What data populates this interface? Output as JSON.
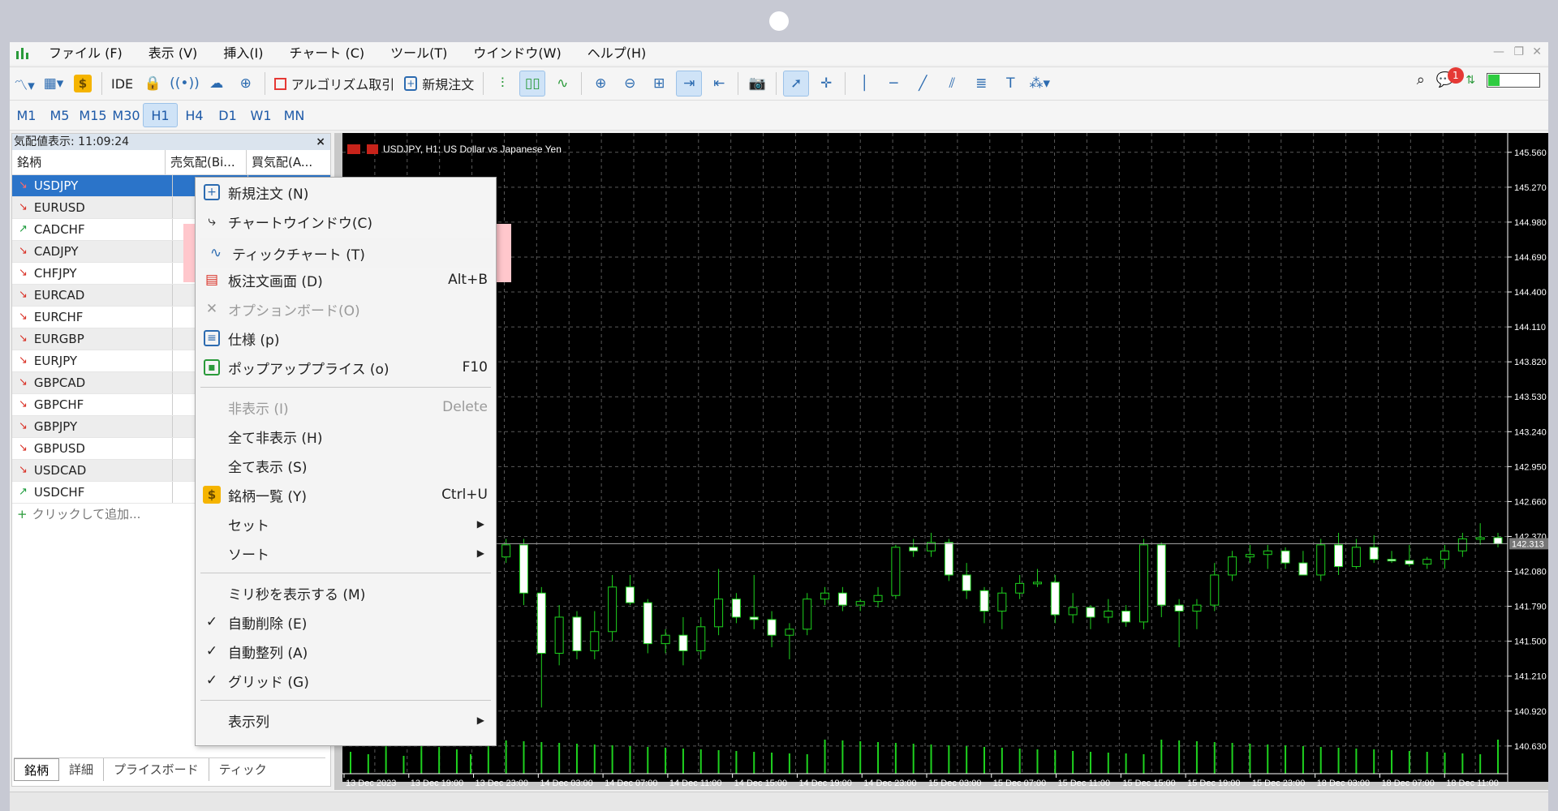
{
  "menubar": {
    "items": [
      "ファイル (F)",
      "表示 (V)",
      "挿入(I)",
      "チャート (C)",
      "ツール(T)",
      "ウインドウ(W)",
      "ヘルプ(H)"
    ]
  },
  "toolbar": {
    "ide_label": "IDE",
    "algo_label": "アルゴリズム取引",
    "new_order_label": "新規注文"
  },
  "timeframes": [
    "M1",
    "M5",
    "M15",
    "M30",
    "H1",
    "H4",
    "D1",
    "W1",
    "MN"
  ],
  "timeframe_active": "H1",
  "market_watch": {
    "title": "気配値表示: 11:09:24",
    "close": "×",
    "columns": [
      "銘柄",
      "売気配(Bi...",
      "買気配(A..."
    ],
    "rows": [
      {
        "symbol": "USDJPY",
        "dir": "down"
      },
      {
        "symbol": "EURUSD",
        "dir": "down"
      },
      {
        "symbol": "CADCHF",
        "dir": "up"
      },
      {
        "symbol": "CADJPY",
        "dir": "down"
      },
      {
        "symbol": "CHFJPY",
        "dir": "down"
      },
      {
        "symbol": "EURCAD",
        "dir": "down"
      },
      {
        "symbol": "EURCHF",
        "dir": "down"
      },
      {
        "symbol": "EURGBP",
        "dir": "down"
      },
      {
        "symbol": "EURJPY",
        "dir": "down"
      },
      {
        "symbol": "GBPCAD",
        "dir": "down"
      },
      {
        "symbol": "GBPCHF",
        "dir": "down"
      },
      {
        "symbol": "GBPJPY",
        "dir": "down"
      },
      {
        "symbol": "GBPUSD",
        "dir": "down"
      },
      {
        "symbol": "USDCAD",
        "dir": "down"
      },
      {
        "symbol": "USDCHF",
        "dir": "up"
      }
    ],
    "add_label": "クリックして追加...",
    "tabs": [
      "銘柄",
      "詳細",
      "プライスボード",
      "ティック"
    ]
  },
  "context_menu": {
    "new_order": "新規注文 (N)",
    "chart_window": "チャートウインドウ(C)",
    "tick_chart": "ティックチャート (T)",
    "depth": "板注文画面 (D)",
    "depth_shortcut": "Alt+B",
    "option_board": "オプションボード(O)",
    "spec": "仕様 (p)",
    "popup_prices": "ポップアッププライス (o)",
    "popup_shortcut": "F10",
    "hide": "非表示 (I)",
    "hide_shortcut": "Delete",
    "hide_all": "全て非表示 (H)",
    "show_all": "全て表示 (S)",
    "symbols": "銘柄一覧 (Y)",
    "symbols_shortcut": "Ctrl+U",
    "set": "セット",
    "sort": "ソート",
    "millis": "ミリ秒を表示する (M)",
    "auto_remove": "自動削除 (E)",
    "auto_arrange": "自動整列 (A)",
    "grid": "グリッド (G)",
    "columns": "表示列"
  },
  "chart_data": {
    "type": "candlestick",
    "title": "USDJPY, H1:  US Dollar vs Japanese Yen",
    "current_price_label": "142.313",
    "y_ticks": [
      145.56,
      145.27,
      144.98,
      144.69,
      144.4,
      144.11,
      143.82,
      143.53,
      143.24,
      142.95,
      142.66,
      142.37,
      142.08,
      141.79,
      141.5,
      141.21,
      140.92,
      140.63
    ],
    "y_tick_labels": [
      "145.560",
      "145.270",
      "144.980",
      "144.690",
      "144.400",
      "144.110",
      "143.820",
      "143.530",
      "143.240",
      "142.950",
      "142.660",
      "142.370",
      "142.080",
      "141.790",
      "141.500",
      "141.210",
      "140.920",
      "140.630"
    ],
    "ylim": [
      140.4,
      145.72
    ],
    "x_labels": [
      "13 Dec 2023",
      "13 Dec 19:00",
      "13 Dec 23:00",
      "14 Dec 03:00",
      "14 Dec 07:00",
      "14 Dec 11:00",
      "14 Dec 15:00",
      "14 Dec 19:00",
      "14 Dec 23:00",
      "15 Dec 03:00",
      "15 Dec 07:00",
      "15 Dec 11:00",
      "15 Dec 15:00",
      "15 Dec 19:00",
      "15 Dec 23:00",
      "18 Dec 03:00",
      "18 Dec 07:00",
      "18 Dec 11:00"
    ],
    "grid": true,
    "colors": {
      "background": "#000000",
      "bull": "#000000",
      "bear": "#ffffff",
      "wick": "#1ed21e",
      "grid": "#5a5a5a",
      "text": "#ffffff"
    },
    "candles": [
      {
        "o": 142.6,
        "h": 142.75,
        "l": 142.3,
        "c": 142.68
      },
      {
        "o": 142.68,
        "h": 142.7,
        "l": 142.1,
        "c": 142.2
      },
      {
        "o": 142.2,
        "h": 142.35,
        "l": 142.15,
        "c": 142.3
      },
      {
        "o": 142.3,
        "h": 142.35,
        "l": 141.8,
        "c": 141.9
      },
      {
        "o": 141.9,
        "h": 141.95,
        "l": 140.95,
        "c": 141.4
      },
      {
        "o": 141.4,
        "h": 141.8,
        "l": 141.3,
        "c": 141.7
      },
      {
        "o": 141.7,
        "h": 141.75,
        "l": 141.35,
        "c": 141.42
      },
      {
        "o": 141.42,
        "h": 141.75,
        "l": 141.35,
        "c": 141.58
      },
      {
        "o": 141.58,
        "h": 142.05,
        "l": 141.5,
        "c": 141.95
      },
      {
        "o": 141.95,
        "h": 142.05,
        "l": 141.8,
        "c": 141.82
      },
      {
        "o": 141.82,
        "h": 141.85,
        "l": 141.4,
        "c": 141.48
      },
      {
        "o": 141.48,
        "h": 141.6,
        "l": 141.4,
        "c": 141.55
      },
      {
        "o": 141.55,
        "h": 141.7,
        "l": 141.3,
        "c": 141.42
      },
      {
        "o": 141.42,
        "h": 141.7,
        "l": 141.35,
        "c": 141.62
      },
      {
        "o": 141.62,
        "h": 142.1,
        "l": 141.55,
        "c": 141.85
      },
      {
        "o": 141.85,
        "h": 141.9,
        "l": 141.65,
        "c": 141.7
      },
      {
        "o": 141.7,
        "h": 142.05,
        "l": 141.6,
        "c": 141.68
      },
      {
        "o": 141.68,
        "h": 141.75,
        "l": 141.45,
        "c": 141.55
      },
      {
        "o": 141.55,
        "h": 141.65,
        "l": 141.35,
        "c": 141.6
      },
      {
        "o": 141.6,
        "h": 141.9,
        "l": 141.55,
        "c": 141.85
      },
      {
        "o": 141.85,
        "h": 141.95,
        "l": 141.8,
        "c": 141.9
      },
      {
        "o": 141.9,
        "h": 141.95,
        "l": 141.75,
        "c": 141.8
      },
      {
        "o": 141.8,
        "h": 141.85,
        "l": 141.75,
        "c": 141.83
      },
      {
        "o": 141.83,
        "h": 141.95,
        "l": 141.78,
        "c": 141.88
      },
      {
        "o": 141.88,
        "h": 142.3,
        "l": 141.85,
        "c": 142.28
      },
      {
        "o": 142.28,
        "h": 142.35,
        "l": 142.2,
        "c": 142.25
      },
      {
        "o": 142.25,
        "h": 142.4,
        "l": 142.2,
        "c": 142.32
      },
      {
        "o": 142.32,
        "h": 142.35,
        "l": 142.0,
        "c": 142.05
      },
      {
        "o": 142.05,
        "h": 142.15,
        "l": 141.85,
        "c": 141.92
      },
      {
        "o": 141.92,
        "h": 141.95,
        "l": 141.65,
        "c": 141.75
      },
      {
        "o": 141.75,
        "h": 141.95,
        "l": 141.6,
        "c": 141.9
      },
      {
        "o": 141.9,
        "h": 142.05,
        "l": 141.85,
        "c": 141.98
      },
      {
        "o": 141.98,
        "h": 142.1,
        "l": 141.95,
        "c": 141.99
      },
      {
        "o": 141.99,
        "h": 142.05,
        "l": 141.65,
        "c": 141.72
      },
      {
        "o": 141.72,
        "h": 141.9,
        "l": 141.65,
        "c": 141.78
      },
      {
        "o": 141.78,
        "h": 141.8,
        "l": 141.6,
        "c": 141.7
      },
      {
        "o": 141.7,
        "h": 141.85,
        "l": 141.65,
        "c": 141.75
      },
      {
        "o": 141.75,
        "h": 141.8,
        "l": 141.62,
        "c": 141.66
      },
      {
        "o": 141.66,
        "h": 142.35,
        "l": 141.6,
        "c": 142.3
      },
      {
        "o": 142.3,
        "h": 142.32,
        "l": 141.7,
        "c": 141.8
      },
      {
        "o": 141.8,
        "h": 141.85,
        "l": 141.45,
        "c": 141.75
      },
      {
        "o": 141.75,
        "h": 141.85,
        "l": 141.6,
        "c": 141.8
      },
      {
        "o": 141.8,
        "h": 142.15,
        "l": 141.75,
        "c": 142.05
      },
      {
        "o": 142.05,
        "h": 142.25,
        "l": 142.0,
        "c": 142.2
      },
      {
        "o": 142.2,
        "h": 142.3,
        "l": 142.15,
        "c": 142.22
      },
      {
        "o": 142.22,
        "h": 142.3,
        "l": 142.1,
        "c": 142.25
      },
      {
        "o": 142.25,
        "h": 142.28,
        "l": 142.1,
        "c": 142.15
      },
      {
        "o": 142.15,
        "h": 142.25,
        "l": 142.05,
        "c": 142.05
      },
      {
        "o": 142.05,
        "h": 142.35,
        "l": 142.0,
        "c": 142.3
      },
      {
        "o": 142.3,
        "h": 142.4,
        "l": 142.05,
        "c": 142.12
      },
      {
        "o": 142.12,
        "h": 142.35,
        "l": 142.1,
        "c": 142.28
      },
      {
        "o": 142.28,
        "h": 142.38,
        "l": 142.15,
        "c": 142.18
      },
      {
        "o": 142.18,
        "h": 142.25,
        "l": 142.15,
        "c": 142.17
      },
      {
        "o": 142.17,
        "h": 142.3,
        "l": 142.12,
        "c": 142.14
      },
      {
        "o": 142.14,
        "h": 142.2,
        "l": 142.1,
        "c": 142.18
      },
      {
        "o": 142.18,
        "h": 142.3,
        "l": 142.1,
        "c": 142.25
      },
      {
        "o": 142.25,
        "h": 142.4,
        "l": 142.2,
        "c": 142.35
      },
      {
        "o": 142.35,
        "h": 142.48,
        "l": 142.3,
        "c": 142.36
      },
      {
        "o": 142.36,
        "h": 142.4,
        "l": 142.28,
        "c": 142.31
      }
    ]
  }
}
